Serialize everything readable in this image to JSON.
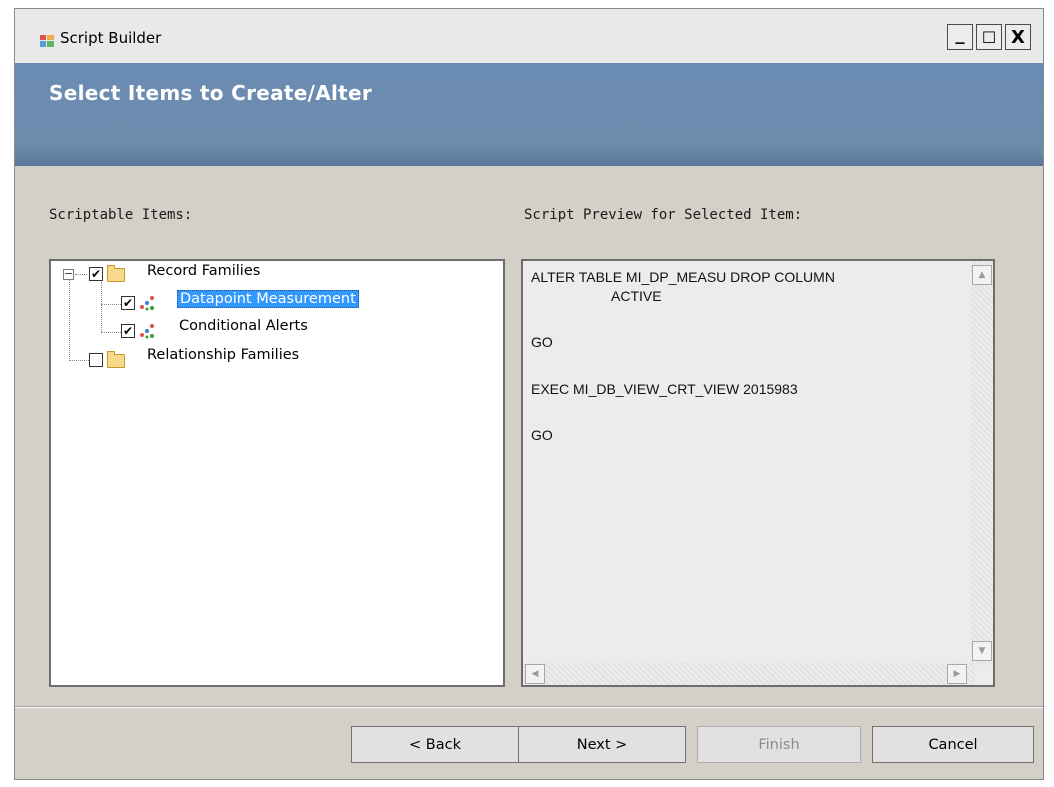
{
  "window": {
    "title": "Script Builder",
    "controls": {
      "minimize": "_",
      "maximize": "☐",
      "close": "X"
    }
  },
  "header": {
    "title": "Select Items to Create/Alter"
  },
  "labels": {
    "scriptable_items": "Scriptable Items:",
    "script_preview": "Script Preview for Selected Item:"
  },
  "tree": {
    "record_families": {
      "label": "Record Families",
      "checked": true,
      "expanded": true
    },
    "children": [
      {
        "label": "Datapoint Measurement",
        "checked": true,
        "selected": true
      },
      {
        "label": "Conditional Alerts",
        "checked": true,
        "selected": false
      }
    ],
    "relationship_families": {
      "label": "Relationship Families",
      "checked": false
    }
  },
  "preview": {
    "lines": [
      "ALTER TABLE MI_DP_MEASU DROP COLUMN",
      "ACTIVE",
      "GO",
      "EXEC MI_DB_VIEW_CRT_VIEW 2015983",
      "GO"
    ]
  },
  "buttons": {
    "back": "< Back",
    "next": "Next >",
    "finish": "Finish",
    "cancel": "Cancel"
  },
  "check_mark": "✔",
  "expander_symbol": "−",
  "colors": {
    "header_band": "#6a8bb3",
    "selection": "#3399ff",
    "dialog_bg": "#d4d0c8"
  }
}
